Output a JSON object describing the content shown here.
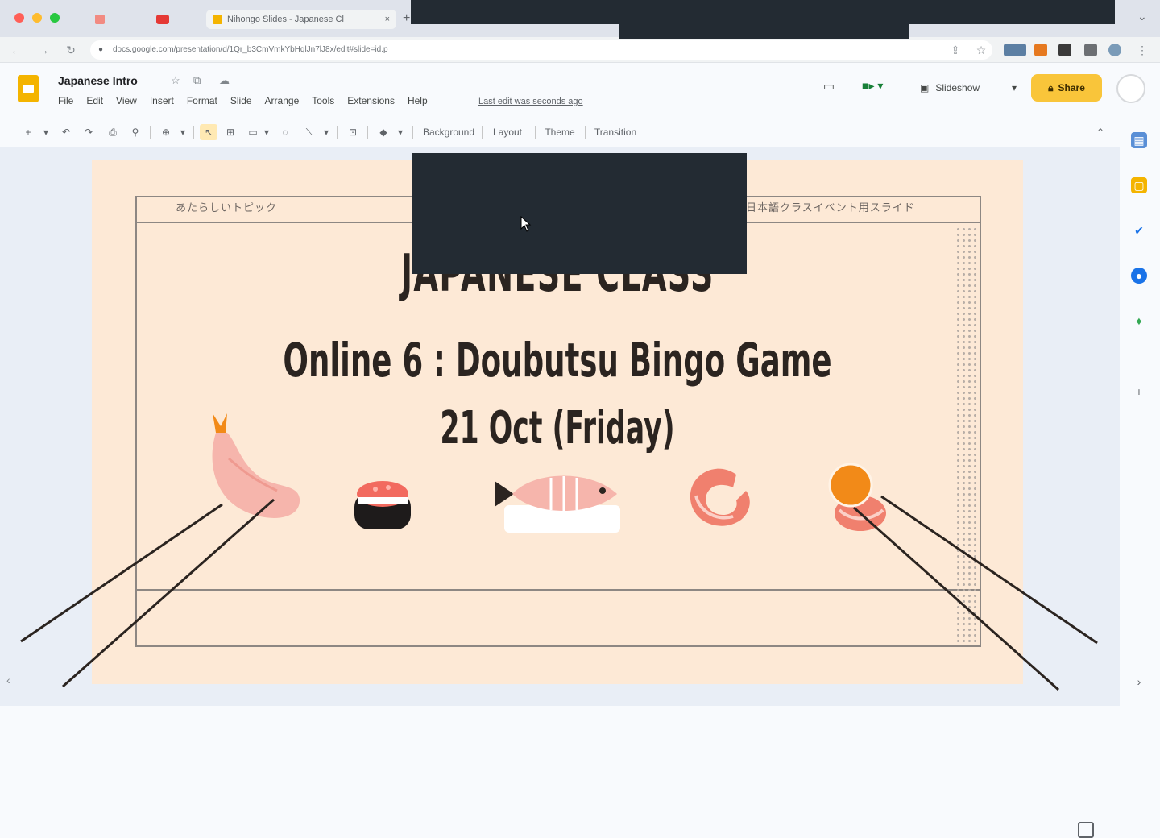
{
  "browser": {
    "tabs": [
      {
        "label": "",
        "active": false
      },
      {
        "label": "",
        "active": false
      },
      {
        "label": "Nihongo Slides - Japanese Cl",
        "active": true
      }
    ],
    "url": "docs.google.com/presentation/d/1Qr_b3CmVmkYbHqlJn7lJ8x/edit#slide=id.p"
  },
  "app": {
    "doc_title": "Japanese Intro",
    "menu": [
      "File",
      "Edit",
      "View",
      "Insert",
      "Format",
      "Slide",
      "Arrange",
      "Tools",
      "Extensions",
      "Help"
    ],
    "last_edit": "Last edit was seconds ago",
    "slideshow_label": "Slideshow",
    "share_label": "Share"
  },
  "toolbar": {
    "background_label": "Background",
    "layout_label": "Layout",
    "theme_label": "Theme",
    "transition_label": "Transition"
  },
  "slide": {
    "header_left": "あたらしいトピック",
    "header_right": "日本語クラスイベント用スライド",
    "title": "JAPANESE CLASS",
    "subtitle": "Online 6 : Doubutsu Bingo Game",
    "date": "21 Oct (Friday)"
  },
  "colors": {
    "slide_bg": "#fde9d6",
    "text_dark": "#2b2420",
    "share_yellow": "#f9c53a",
    "sushi_pink": "#f08a80",
    "orange": "#f28a18",
    "overlay": "#232b33"
  }
}
